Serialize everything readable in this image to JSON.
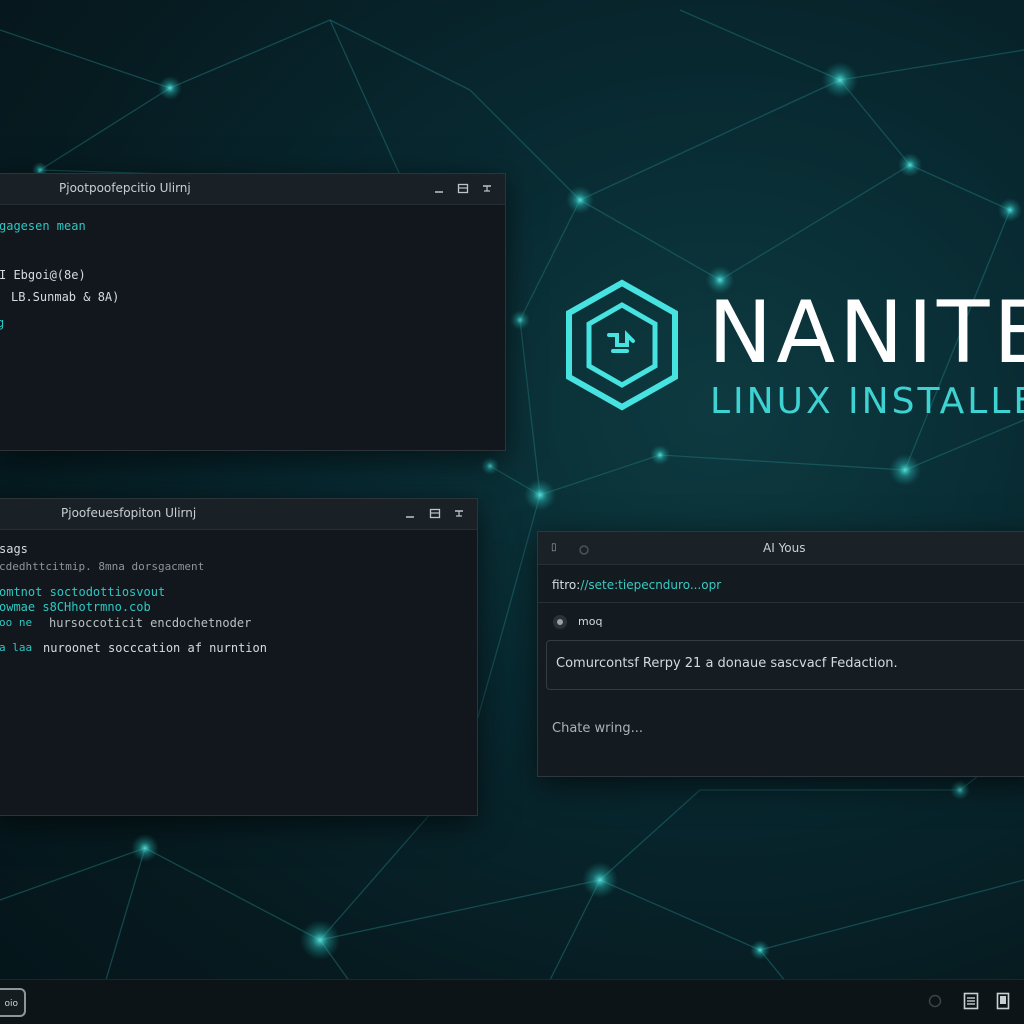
{
  "brand": {
    "name": "NANITE",
    "subtitle": "LINUX INSTALLER",
    "accent": "#3fd2d2"
  },
  "terminal1": {
    "title": "Pjootpoofepcitio Ulirnj",
    "lines": [
      {
        "text": "gagesen  mean",
        "color": "#2fc7c2"
      },
      {
        "text": "I  Ebgoi@(8e)",
        "color": "#d6dbde"
      },
      {
        "text": "LB.Sunmab & 8A)",
        "color": "#d6dbde"
      },
      {
        "text": "g",
        "color": "#2fc7c2"
      }
    ]
  },
  "terminal2": {
    "title": "Pjoofeuesfopiton Ulirnj",
    "lines": [
      {
        "text": "sags",
        "color": "#d6dbde"
      },
      {
        "text": "cdedhttcitmip. 8mna  dorsgacment",
        "color": "#8c9599"
      },
      {
        "text": "omtnot  soctodottiosvout",
        "color": "#2fc7c2"
      },
      {
        "text": "owmae  s8CHhotrmno.cob",
        "color": "#2fc7c2"
      },
      {
        "text": "hursoccoticit  encdochetnoder",
        "color": "#8c9599"
      },
      {
        "text": "nuroonet  socccation  af  nurntion",
        "color": "#d6dbde"
      }
    ],
    "prefixes": [
      "",
      "",
      "",
      "",
      "oo ne",
      "a  laa"
    ]
  },
  "chat": {
    "title": "AI Yous",
    "url_prefix": "fitro:",
    "url_rest": "//sete:tiepecnduro...opr",
    "user": "moq",
    "message": "Comurcontsf Rerpy 21 a donaue sascvacf Fedaction.",
    "typing": "Chate wring..."
  },
  "taskbar": {
    "start_label": "oio"
  }
}
